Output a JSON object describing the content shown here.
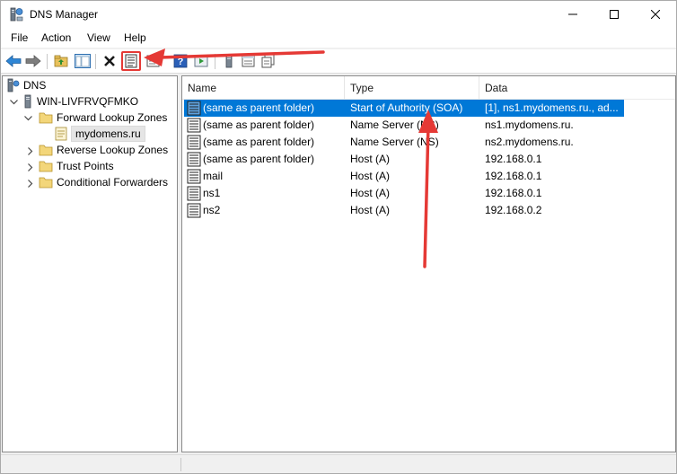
{
  "window": {
    "title": "DNS Manager",
    "icon": "dns-manager-icon"
  },
  "menu": {
    "file": "File",
    "action": "Action",
    "view": "View",
    "help": "Help"
  },
  "toolbar": {
    "buttons": [
      "back-icon",
      "forward-icon",
      "up-folder-icon",
      "show-hide-tree-icon",
      "delete-icon",
      "properties-icon",
      "export-list-icon",
      "help-icon",
      "run-icon",
      "server-icon",
      "new-record-icon",
      "copy-icon"
    ]
  },
  "tree": {
    "root": "DNS",
    "server": "WIN-LIVFRVQFMKO",
    "forward_zones": "Forward Lookup Zones",
    "zone": "mydomens.ru",
    "reverse_zones": "Reverse Lookup Zones",
    "trust_points": "Trust Points",
    "conditional_forwarders": "Conditional Forwarders"
  },
  "details": {
    "columns": {
      "name": "Name",
      "type": "Type",
      "data": "Data"
    },
    "rows": [
      {
        "name": "(same as parent folder)",
        "type": "Start of Authority (SOA)",
        "data": "[1], ns1.mydomens.ru., ad..."
      },
      {
        "name": "(same as parent folder)",
        "type": "Name Server (NS)",
        "data": "ns1.mydomens.ru."
      },
      {
        "name": "(same as parent folder)",
        "type": "Name Server (NS)",
        "data": "ns2.mydomens.ru."
      },
      {
        "name": "(same as parent folder)",
        "type": "Host (A)",
        "data": "192.168.0.1"
      },
      {
        "name": "mail",
        "type": "Host (A)",
        "data": "192.168.0.1"
      },
      {
        "name": "ns1",
        "type": "Host (A)",
        "data": "192.168.0.1"
      },
      {
        "name": "ns2",
        "type": "Host (A)",
        "data": "192.168.0.2"
      }
    ]
  },
  "colors": {
    "selection": "#0078d7",
    "annotation_arrow": "#e53935"
  }
}
